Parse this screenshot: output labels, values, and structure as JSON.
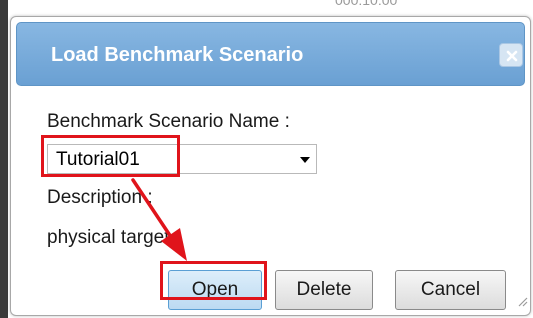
{
  "background": {
    "partial_text": "000:10:00"
  },
  "dialog": {
    "title": "Load Benchmark Scenario",
    "close_icon": "close-icon",
    "name_label": "Benchmark Scenario Name :",
    "scenario_select": {
      "selected": "Tutorial01"
    },
    "description_label": "Description :",
    "description_value": "physical target",
    "buttons": {
      "open": "Open",
      "delete": "Delete",
      "cancel": "Cancel"
    }
  },
  "annotations": {
    "highlight_color": "#e0141b",
    "arrow_icon": "arrow-icon"
  },
  "colors": {
    "titlebar_top": "#88b7e2",
    "titlebar_bottom": "#6aa0d3",
    "primary_button_border": "#5a9fd4"
  }
}
